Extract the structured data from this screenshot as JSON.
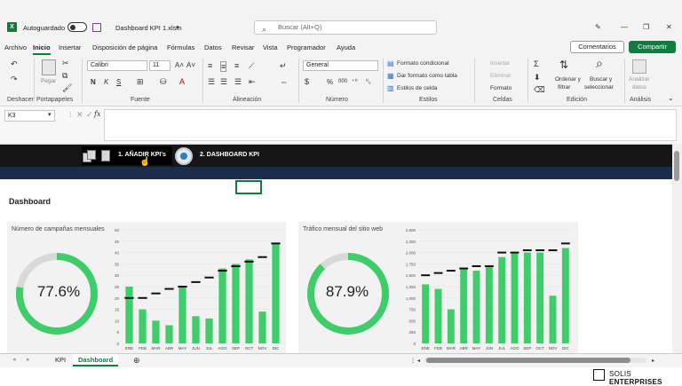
{
  "titlebar": {
    "autosave_label": "Autoguardado",
    "file_name": "Dashboard KPI 1.xlsm",
    "search_placeholder": "Buscar (Alt+Q)"
  },
  "menu": {
    "items": [
      "Archivo",
      "Inicio",
      "Insertar",
      "Disposición de página",
      "Fórmulas",
      "Datos",
      "Revisar",
      "Vista",
      "Programador",
      "Ayuda"
    ],
    "active": "Inicio",
    "comments_label": "Comentarios",
    "share_label": "Compartir"
  },
  "ribbon": {
    "undo_group": "Deshacer",
    "clipboard_group": "Portapapeles",
    "paste_label": "Pegar",
    "font_group": "Fuente",
    "font_name": "Calibri",
    "font_size": "11",
    "bold": "N",
    "italic": "K",
    "underline": "S",
    "alignment_group": "Alineación",
    "number_group": "Número",
    "number_format": "General",
    "percent": "%",
    "thousands": "000",
    "styles_group": "Estilos",
    "conditional_format": "Formato condicional",
    "format_as_table": "Dar formato como tabla",
    "cell_styles": "Estilos de celda",
    "cells_group": "Celdas",
    "insert": "Insertar",
    "delete": "Eliminar",
    "format": "Formato",
    "editing_group": "Edición",
    "sort_filter_1": "Ordenar y",
    "sort_filter_2": "filtrar",
    "find_select_1": "Buscar y",
    "find_select_2": "seleccionar",
    "analysis_group": "Análisis",
    "analyze_1": "Analizar",
    "analyze_2": "datos"
  },
  "formula_bar": {
    "name_box": "K3",
    "fx": "fx",
    "value": ""
  },
  "sheet_nav": {
    "tab1": "1. AÑADIR KPI's",
    "tab2": "2. DASHBOARD KPI"
  },
  "dashboard": {
    "title": "Dashboard"
  },
  "colors": {
    "excel_green": "#107c41",
    "bar_green": "#3fcc6a",
    "donut_track": "#d9d9d9",
    "target_line": "#111111",
    "nav_dark": "#161616",
    "nav_strip": "#1a2d4a"
  },
  "chart_data": [
    {
      "type": "donut",
      "title": "Número de campañas mensuales",
      "value": 77.6,
      "label": "77.6%"
    },
    {
      "type": "bar",
      "title": "",
      "categories": [
        "ENE",
        "FEB",
        "MAR",
        "ABR",
        "MAY",
        "JUN",
        "JUL",
        "AGO",
        "SEP",
        "OCT",
        "NOV",
        "DIC"
      ],
      "series": [
        {
          "values": [
            25,
            15,
            10,
            8,
            25,
            12,
            11,
            33,
            35,
            37,
            14,
            44
          ]
        },
        {
          "values": [
            20,
            20,
            22,
            24,
            25,
            27,
            29,
            32,
            34,
            36,
            38,
            44
          ],
          "style": "target-dash"
        }
      ],
      "ylim": [
        0,
        50
      ],
      "yticks": [
        0,
        5,
        10,
        15,
        20,
        25,
        30,
        35,
        40,
        45,
        50
      ],
      "grid": true
    },
    {
      "type": "donut",
      "title": "Tráfico mensual del sitio web",
      "value": 87.9,
      "label": "87.9%"
    },
    {
      "type": "bar",
      "title": "",
      "categories": [
        "ENE",
        "FEB",
        "MAR",
        "ABR",
        "MAY",
        "JUN",
        "JUL",
        "AGO",
        "SEP",
        "OCT",
        "NOV",
        "DIC"
      ],
      "series": [
        {
          "values": [
            1300,
            1200,
            750,
            1650,
            1600,
            1700,
            1900,
            2000,
            2000,
            2000,
            1050,
            2100
          ]
        },
        {
          "values": [
            1500,
            1550,
            1600,
            1650,
            1700,
            1700,
            2000,
            2000,
            2050,
            2050,
            2050,
            2200
          ],
          "style": "target-dash"
        }
      ],
      "ylim": [
        0,
        2500
      ],
      "yticks": [
        0,
        250,
        500,
        750,
        1000,
        1250,
        1500,
        1750,
        2000,
        2250,
        2500
      ],
      "ytick_labels": [
        "0",
        "250",
        "500",
        "750",
        "1,000",
        "1,250",
        "1,500",
        "1,750",
        "2,000",
        "2,250",
        "2,500"
      ],
      "grid": true
    }
  ],
  "tabs": {
    "sheet1": "KPI",
    "sheet2": "Dashboard",
    "active": "Dashboard"
  },
  "watermark": {
    "brand_light": "SOLIS",
    "brand_bold": "ENTERPRISES"
  }
}
